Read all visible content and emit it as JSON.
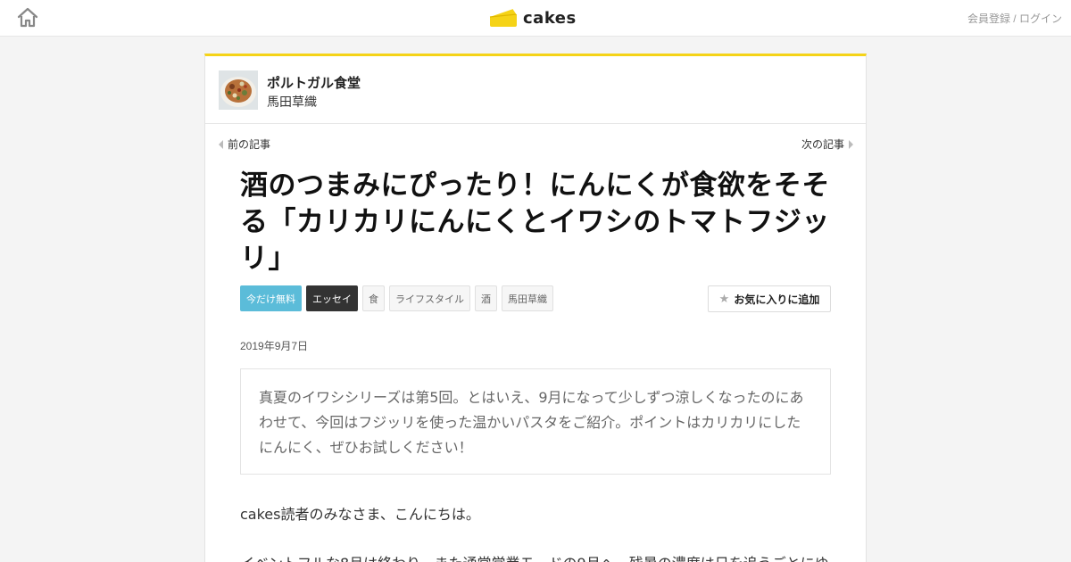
{
  "header": {
    "logo_text": "cakes",
    "auth_register": "会員登録",
    "auth_separator": " / ",
    "auth_login": "ログイン"
  },
  "series": {
    "title": "ポルトガル食堂",
    "author": "馬田草織"
  },
  "nav": {
    "prev_label": "前の記事",
    "next_label": "次の記事"
  },
  "article": {
    "title": "酒のつまみにぴったり！にんにくが食欲をそそる「カリカリにんにくとイワシのトマトフジッリ」",
    "tags": [
      "今だけ無料",
      "エッセイ",
      "食",
      "ライフスタイル",
      "酒",
      "馬田草織"
    ],
    "favorite_label": "お気に入りに追加",
    "date": "2019年9月7日",
    "lead": "真夏のイワシシリーズは第5回。とはいえ、9月になって少しずつ涼しくなったのにあわせて、今回はフジッリを使った温かいパスタをご紹介。ポイントはカリカリにしたにんにく、ぜひお試しください！",
    "body": [
      "cakes読者のみなさま、こんにちは。",
      "イベントフルな8月は終わり、また通常営業モードの9月へ。残暑の濃度は日を追うごとにゆ"
    ]
  },
  "colors": {
    "accent_yellow": "#f5d317",
    "tag_free": "#5bbcd9",
    "tag_essay": "#333333"
  }
}
